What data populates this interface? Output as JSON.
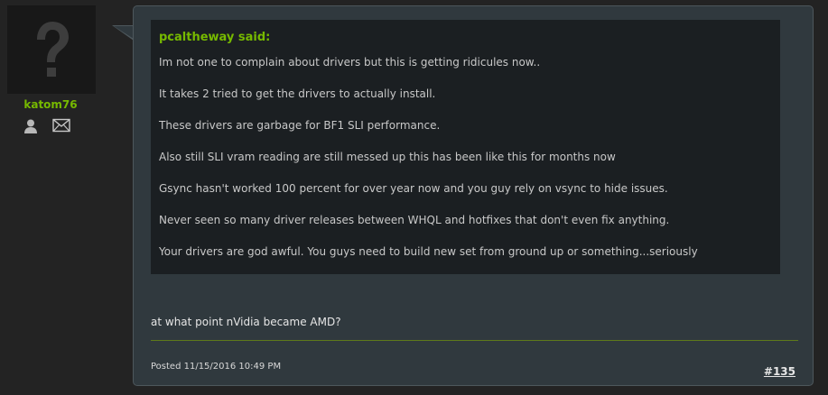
{
  "user": {
    "name": "katom76",
    "avatar_icon": "question-mark-avatar",
    "icons": [
      "profile-icon",
      "mail-icon"
    ]
  },
  "post": {
    "quote": {
      "author": "pcaltheway said:",
      "lines": [
        "Im not one to complain about drivers but this is getting ridicules now..",
        "It takes 2 tried to get the drivers to actually install.",
        "These drivers are garbage for BF1 SLI performance.",
        "Also still SLI vram reading are still messed up this has been like this for months now",
        "Gsync hasn't worked 100 percent for over year now and you guy rely on vsync to hide issues.",
        "Never seen so many driver releases between WHQL and hotfixes that don't even fix anything.",
        "Your drivers are god awful. You guys need to build new set from ground up or something...seriously"
      ]
    },
    "reply": "at what point nVidia became AMD?",
    "posted": "Posted 11/15/2016 10:49 PM",
    "number": "#135"
  },
  "colors": {
    "accent": "#76b900",
    "background": "#232323",
    "post_bg": "#30393e",
    "quote_bg": "#1b1f22"
  }
}
